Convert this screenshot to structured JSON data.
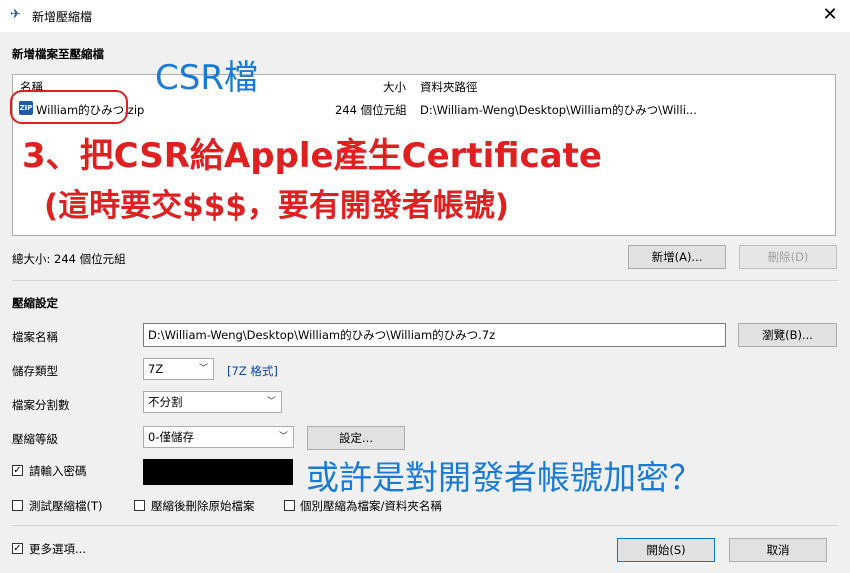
{
  "window": {
    "title": "新增壓縮檔"
  },
  "add_section": {
    "heading": "新增檔案至壓縮檔",
    "columns": {
      "name": "名稱",
      "size": "大小",
      "path": "資料夾路徑"
    },
    "files": [
      {
        "name": "William的ひみつ.zip",
        "size": "244 個位元組",
        "path": "D:\\William-Weng\\Desktop\\William的ひみつ\\Willi..."
      }
    ],
    "total_size": "總大小: 244 個位元組",
    "add_button": "新增(A)...",
    "remove_button": "刪除(D)"
  },
  "compress_settings": {
    "heading": "壓縮設定",
    "filename_label": "檔案名稱",
    "filename_value": "D:\\William-Weng\\Desktop\\William的ひみつ\\William的ひみつ.7z",
    "browse_button": "瀏覽(B)...",
    "storage_label": "儲存類型",
    "storage_value": "7Z",
    "format_link": "[7Z 格式]",
    "split_label": "檔案分割數",
    "split_value": "不分割",
    "level_label": "壓縮等級",
    "level_value": "0-僅儲存",
    "settings_button": "設定...",
    "password_label": "請輸入密碼",
    "password_checked": true,
    "test_label": "測試壓縮檔(T)",
    "delete_label": "壓縮後刪除原始檔案",
    "individual_label": "個別壓縮為檔案/資料夾名稱"
  },
  "footer": {
    "more_options_label": "更多選項...",
    "more_options_checked": true,
    "start_button": "開始(S)",
    "cancel_button": "取消"
  },
  "annotations": {
    "csr": "CSR檔",
    "step3": "3、把CSR給Apple產生Certificate",
    "cost": "(這時要交$$$，要有開發者帳號)",
    "question": "或許是對開發者帳號加密？"
  },
  "colors": {
    "annotation_red": "#e02020",
    "annotation_blue": "#1a7bd6",
    "zip_icon": "#1e5aa8"
  },
  "icons": {
    "app": "pin-icon",
    "close": "close-icon",
    "file": "zip-file-icon",
    "dropdown": "chevron-down-icon"
  }
}
